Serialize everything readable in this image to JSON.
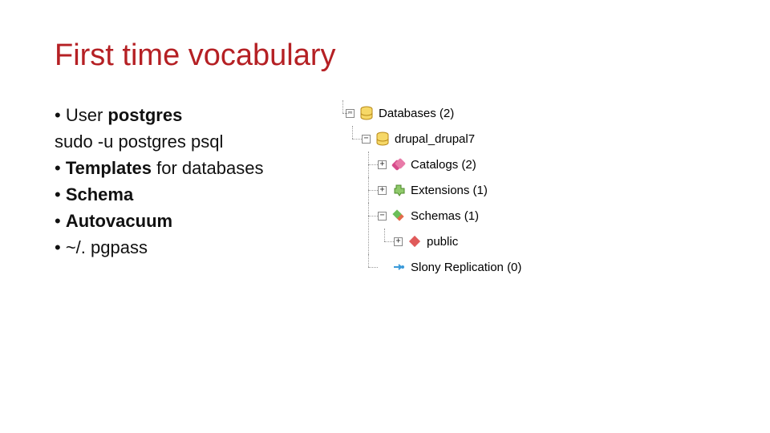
{
  "title": "First time vocabulary",
  "bullets": {
    "l1_pre": "• User ",
    "l1_bold": "postgres",
    "l2": "sudo -u postgres psql",
    "l3_pre": "• ",
    "l3_bold": "Templates",
    "l3_post": " for databases",
    "l4_pre": "• ",
    "l4_bold": "Schema",
    "l5_pre": "• ",
    "l5_bold": "Autovacuum",
    "l6": "• ~/. pgpass"
  },
  "tree": {
    "databases": {
      "label": "Databases (2)",
      "expander": "−"
    },
    "drupal": {
      "label": "drupal_drupal7",
      "expander": "−"
    },
    "catalogs": {
      "label": "Catalogs (2)",
      "expander": "+"
    },
    "extensions": {
      "label": "Extensions (1)",
      "expander": "+"
    },
    "schemas": {
      "label": "Schemas (1)",
      "expander": "−"
    },
    "public": {
      "label": "public",
      "expander": "+"
    },
    "slony": {
      "label": "Slony Replication (0)",
      "expander": ""
    }
  }
}
